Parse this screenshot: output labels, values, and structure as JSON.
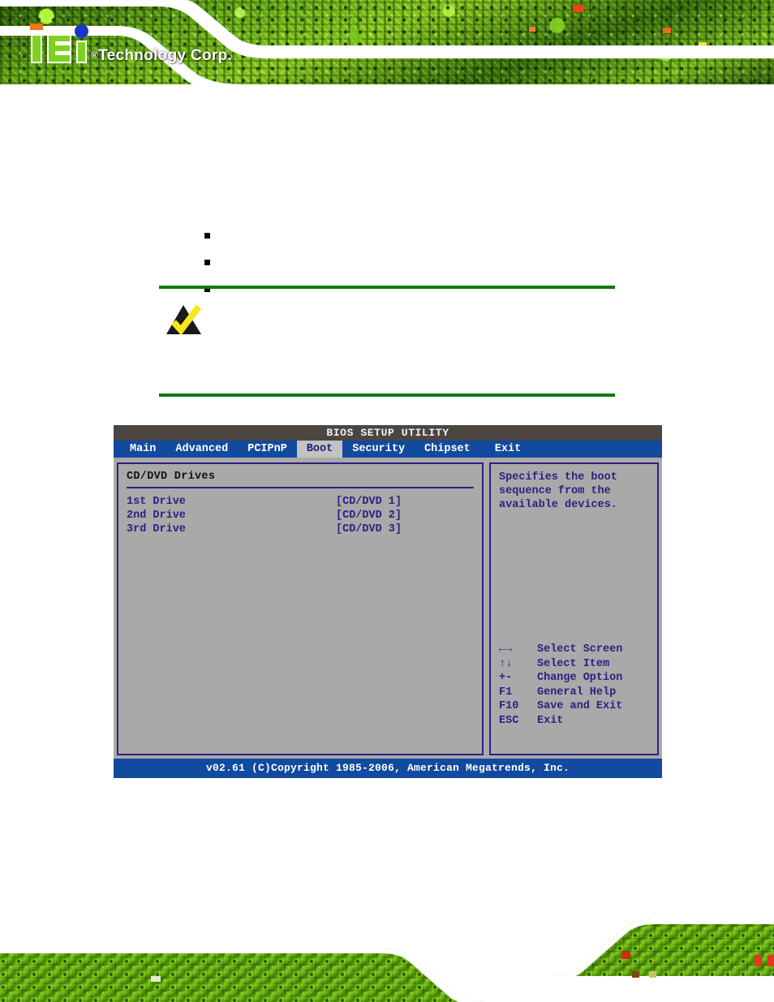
{
  "header": {
    "logo_name": "iEi",
    "logo_text": "Technology Corp.",
    "registered_mark": "®"
  },
  "document": {
    "bullets": [
      "",
      "",
      ""
    ],
    "note": {
      "icon": "note-triangle-check-icon",
      "title": "",
      "text": ""
    }
  },
  "bios": {
    "title": "BIOS SETUP UTILITY",
    "menu_tabs": [
      {
        "label": "Main",
        "active": false
      },
      {
        "label": "Advanced",
        "active": false
      },
      {
        "label": "PCIPnP",
        "active": false
      },
      {
        "label": "Boot",
        "active": true
      },
      {
        "label": "Security",
        "active": false
      },
      {
        "label": "Chipset",
        "active": false
      },
      {
        "label": "Exit",
        "active": false
      }
    ],
    "section_title": "CD/DVD Drives",
    "drives": [
      {
        "label": "1st Drive",
        "value": "[CD/DVD 1]"
      },
      {
        "label": "2nd Drive",
        "value": "[CD/DVD 2]"
      },
      {
        "label": "3rd Drive",
        "value": "[CD/DVD 3]"
      }
    ],
    "help_text": "Specifies the boot sequence from the available devices.",
    "key_legend": [
      {
        "key": "←→",
        "desc": "Select Screen"
      },
      {
        "key": "↑↓",
        "desc": "Select Item"
      },
      {
        "key": "+-",
        "desc": "Change Option"
      },
      {
        "key": "F1",
        "desc": "General Help"
      },
      {
        "key": "F10",
        "desc": "Save and Exit"
      },
      {
        "key": "ESC",
        "desc": "Exit"
      }
    ],
    "footer": "v02.61 (C)Copyright 1985-2006, American Megatrends, Inc."
  },
  "colors": {
    "banner_green": "#67b412",
    "rule_green": "#0b7a0b",
    "bios_blue": "#114a9e",
    "bios_titlebar": "#4b4641",
    "bios_panel_bg": "#a9a9a9",
    "bios_border": "#2d2080",
    "bios_text": "#2d2080",
    "active_tab_bg": "#c2c2c2"
  }
}
